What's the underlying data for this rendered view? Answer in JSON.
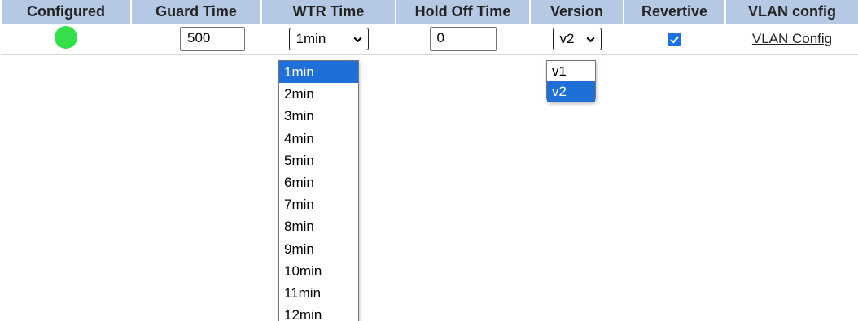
{
  "headers": [
    "Configured",
    "Guard Time",
    "WTR Time",
    "Hold Off Time",
    "Version",
    "Revertive",
    "VLAN config"
  ],
  "row": {
    "configured_status_color": "#33e04a",
    "guard_time": "500",
    "wtr_time": "1min",
    "hold_off_time": "0",
    "version": "v2",
    "revertive_checked": true,
    "vlan_config_link": "VLAN Config"
  },
  "wtr_options": [
    "1min",
    "2min",
    "3min",
    "4min",
    "5min",
    "6min",
    "7min",
    "8min",
    "9min",
    "10min",
    "11min",
    "12min"
  ],
  "wtr_selected_index": 0,
  "version_options": [
    "v1",
    "v2"
  ],
  "version_selected_index": 1,
  "colors": {
    "header_bg": "#b5c9e4",
    "selection": "#1e6fd8",
    "checkbox": "#1a73e8"
  }
}
